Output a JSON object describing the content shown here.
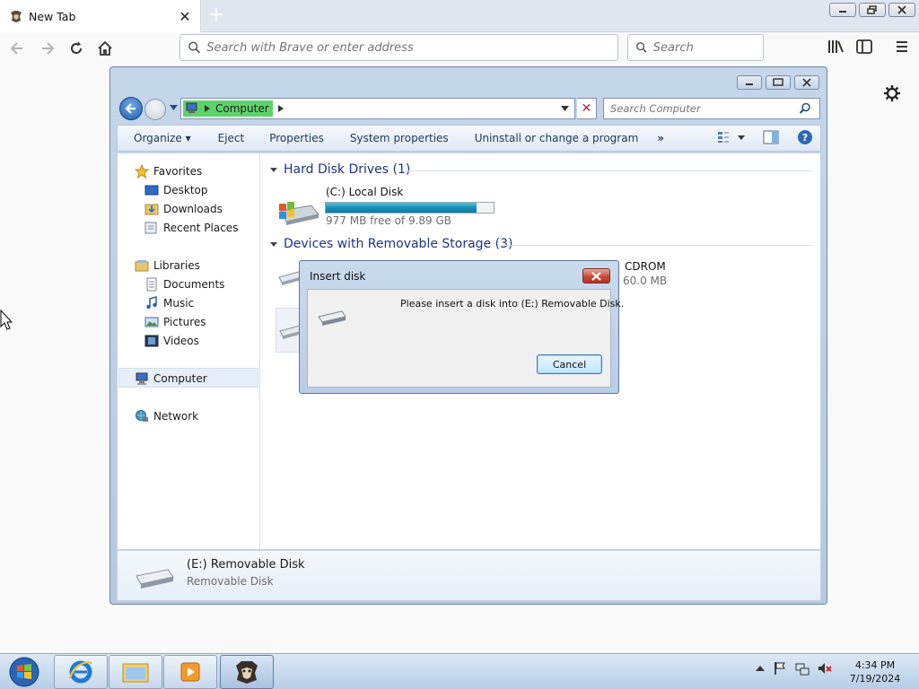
{
  "browser": {
    "tab_title": "New Tab",
    "url_placeholder": "Search with Brave or enter address",
    "search_placeholder": "Search"
  },
  "explorer": {
    "breadcrumb": "Computer",
    "search_placeholder": "Search Computer",
    "commands": [
      "Organize",
      "Eject",
      "Properties",
      "System properties",
      "Uninstall or change a program"
    ],
    "more_commands": "»",
    "nav": {
      "favorites": "Favorites",
      "desktop": "Desktop",
      "downloads": "Downloads",
      "recent_places": "Recent Places",
      "libraries": "Libraries",
      "documents": "Documents",
      "music": "Music",
      "pictures": "Pictures",
      "videos": "Videos",
      "computer": "Computer",
      "network": "Network"
    },
    "groups": {
      "hard_disks": "Hard Disk Drives (1)",
      "removable": "Devices with Removable Storage (3)"
    },
    "drives": {
      "c_name": "(C:) Local Disk",
      "c_free": "977 MB free of 9.89 GB",
      "c_used_fraction": 0.9,
      "cdrom_name": "CDROM",
      "cdrom_size": "60.0 MB"
    },
    "details": {
      "name": "(E:) Removable Disk",
      "type": "Removable Disk"
    }
  },
  "dialog": {
    "title": "Insert disk",
    "message": "Please insert a disk into (E:) Removable Disk.",
    "cancel": "Cancel"
  },
  "taskbar": {
    "time": "4:34 PM",
    "date": "7/19/2024"
  },
  "colors": {
    "accent": "#1f5fae",
    "group_heading": "#1e3287",
    "address_highlight": "#5cd36a",
    "capacity_bar": "#1a8eb8",
    "dialog_close": "#c84b3c"
  }
}
